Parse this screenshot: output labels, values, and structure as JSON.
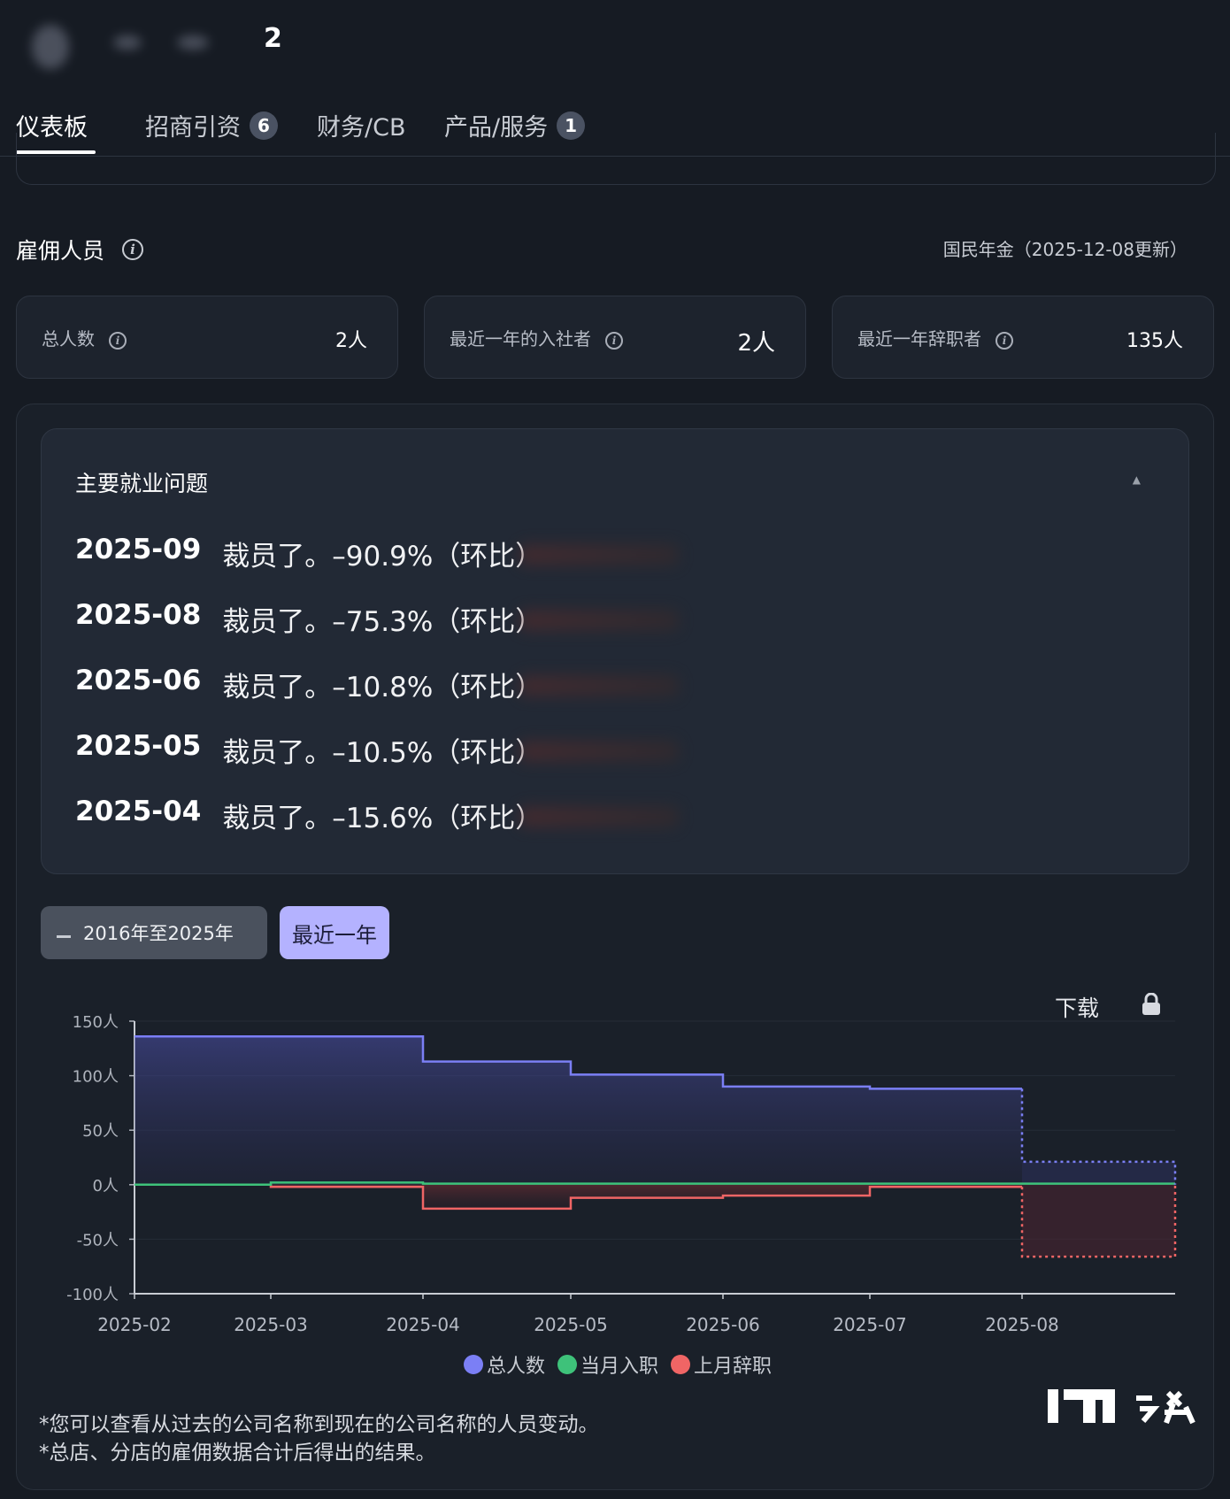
{
  "header": {
    "visible_char": "2"
  },
  "tabs": [
    {
      "label": "仪表板",
      "badge": ""
    },
    {
      "label": "招商引资",
      "badge": "6"
    },
    {
      "label": "财务/CB",
      "badge": ""
    },
    {
      "label": "产品/服务",
      "badge": "1"
    }
  ],
  "section": {
    "title": "雇佣人员",
    "pension_note": "国民年金（2025-12-08更新）"
  },
  "stats": [
    {
      "label": "总人数",
      "value": "2人"
    },
    {
      "label": "最近一年的入社者",
      "value": "2人"
    },
    {
      "label": "最近一年辞职者",
      "value": "135人"
    }
  ],
  "issues": {
    "title": "主要就业问题",
    "collapse_icon": "chevron-up-icon",
    "items": [
      {
        "date": "2025-09",
        "text": "裁员了。–90.9%（环比）"
      },
      {
        "date": "2025-08",
        "text": "裁员了。–75.3%（环比）"
      },
      {
        "date": "2025-06",
        "text": "裁员了。–10.8%（环比）"
      },
      {
        "date": "2025-05",
        "text": "裁员了。–10.5%（环比）"
      },
      {
        "date": "2025-04",
        "text": "裁员了。–15.6%（环比）"
      }
    ]
  },
  "range_buttons": {
    "all": "2016年至2025年",
    "recent": "最近一年"
  },
  "download": {
    "label": "下载",
    "icon": "lock-icon"
  },
  "colors": {
    "total": "#7b7ff5",
    "joined": "#3ec27a",
    "resigned": "#f06565",
    "active_button": "#b4b2ff"
  },
  "chart_data": {
    "type": "line",
    "step": true,
    "x": [
      "2025-02",
      "2025-03",
      "2025-04",
      "2025-05",
      "2025-06",
      "2025-07",
      "2025-08"
    ],
    "y_ticks": [
      "150人",
      "100人",
      "50人",
      "0人",
      "-50人",
      "-100人"
    ],
    "ylim": [
      -100,
      150
    ],
    "series": [
      {
        "name": "总人数",
        "color": "#7b7ff5",
        "values": [
          136,
          136,
          113,
          101,
          90,
          88,
          21
        ],
        "projected_last": true
      },
      {
        "name": "当月入职",
        "color": "#3ec27a",
        "values": [
          0,
          2,
          1,
          1,
          1,
          1,
          1
        ]
      },
      {
        "name": "上月辞职",
        "color": "#f06565",
        "values": [
          0,
          -2,
          -22,
          -12,
          -10,
          -2,
          -66
        ],
        "projected_last": true
      }
    ],
    "legend_position": "bottom"
  },
  "notes": [
    "*您可以查看从过去的公司名称到现在的公司名称的人员变动。",
    "*总店、分店的雇佣数据合计后得出的结果。"
  ]
}
